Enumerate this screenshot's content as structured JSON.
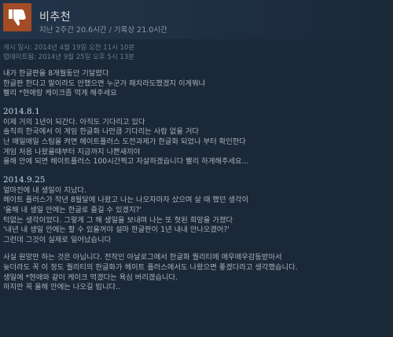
{
  "review": {
    "verdict": "비추천",
    "hours": "지난 2주간 20.6시간 / 기록상 21.0시간",
    "posted": "게시 일시: 2014년 4월 19일 오전 11시 10분",
    "updated": "업데이트됨: 2014년 9월 25일 오후 5시 13분",
    "intro": [
      "내가 한글판을 8개월동안 기달렸다",
      "한글판 한다고 말이라도 안했으면 누군가 패치라도했겠지 이게뭐냐",
      "빨리 *현애랑 케이크좀 먹게 해주세요"
    ],
    "update1": {
      "heading": "2014.8.1",
      "lines": [
        "이제 거의 1년이 되간다. 아직도 기다리고 있다",
        "솔직히 한국에서 이 게임 한글화 나만큼 기다리는 사람 없을 거다",
        "난 매일매일 스팀을 켜면 헤이트플러스 도전과제가 한글화 되었나 부터 확인한다",
        "게임 처음 나왔을때부터 지금까지 나쁜새끼야",
        "올해 안에 되면 헤이트플러스 100시간찍고 자살하겠습니다 빨리 하게해주세요..."
      ]
    },
    "update2": {
      "heading": "2014.9.25",
      "lines": [
        "얼마전에 내 생일이 지났다.",
        "헤이트 플러스가 작년 8월달에 나왔고 나는 나오자마자 샀으며 살 때 했던 생각이",
        "'올해 내 생일 안에는 한글로 즐길 수 있겠지?'",
        "턱없는 생각이었다. 그렇게 그 해 생일을 보내며 나는 또 헛된 희망을 가졌다",
        "'내년 내 생일 안에는 할 수 있을꺼야 설마 한글판이 1년 내내 안나오겠어?'",
        "그런데 그것이 실제로 일어났습니다"
      ]
    },
    "closing": [
      "사실 원망만 하는 것은 아닙니다. 전작인 아날로그에서 한글화 퀄리티에 매우매우감동받아서",
      "늦더라도 꼭 이 정도 퀄리티의 한글화가 헤이트 플러스에서도 나왔으면 좋겠다라고 생각했습니다.",
      "생일에 *현애와 같이 케이크 먹겠다는 욕심 버리겠습니다.",
      "하지만 꼭 올해 안에는 나오길 빕니다.."
    ]
  },
  "colors": {
    "background": "#1b2838",
    "thumb_down_bg": "#a34c25",
    "text": "#acb2b8"
  },
  "icons": {
    "verdict_icon": "thumbs-down-icon"
  }
}
